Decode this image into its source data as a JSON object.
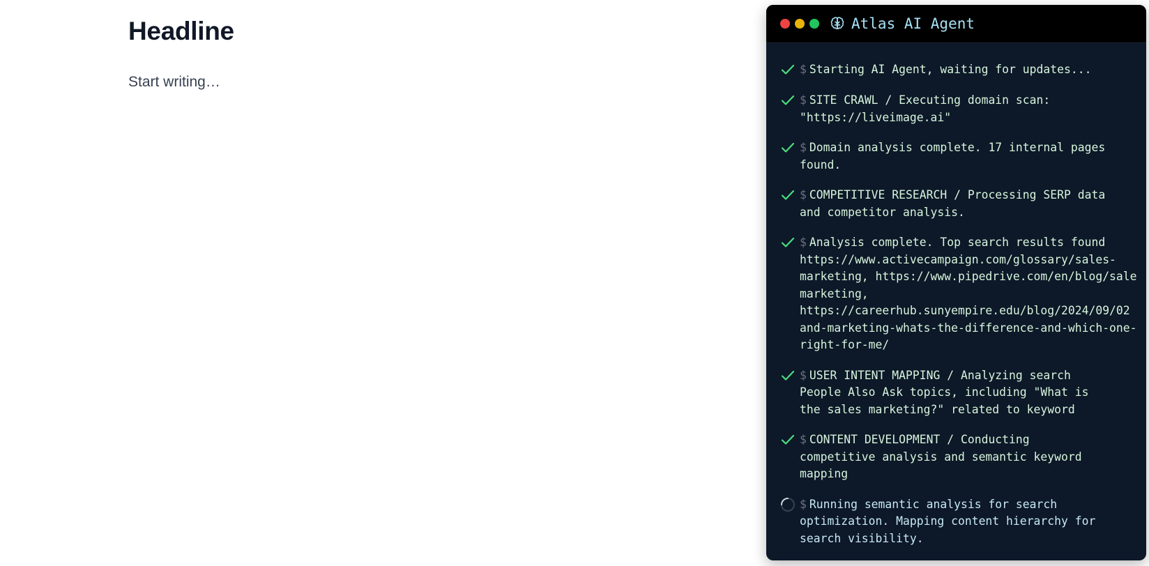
{
  "editor": {
    "headline": "Headline",
    "body_placeholder": "Start writing…"
  },
  "agent": {
    "title": "Atlas AI Agent",
    "title_icon": "brain-icon",
    "window_controls": [
      "close",
      "minimize",
      "maximize"
    ],
    "colors": {
      "background": "#0d1828",
      "titlebar": "#000000",
      "accent_check": "#4ade80",
      "title_text": "#a5e1f5"
    },
    "prompt": "$",
    "entries": [
      {
        "status": "done",
        "lines": [
          "Starting AI Agent, waiting for updates..."
        ]
      },
      {
        "status": "done",
        "lines": [
          "SITE CRAWL / Executing domain scan:",
          "\"https://liveimage.ai\""
        ]
      },
      {
        "status": "done",
        "lines": [
          "Domain analysis complete. 17 internal pages",
          "found."
        ]
      },
      {
        "status": "done",
        "lines": [
          "COMPETITIVE RESEARCH / Processing SERP data",
          "and competitor analysis."
        ]
      },
      {
        "status": "done",
        "lines": [
          "Analysis complete. Top search results found",
          "https://www.activecampaign.com/glossary/sales-",
          "marketing, https://www.pipedrive.com/en/blog/sale",
          "marketing,",
          "https://careerhub.sunyempire.edu/blog/2024/09/02",
          "and-marketing-whats-the-difference-and-which-one-",
          "right-for-me/"
        ]
      },
      {
        "status": "done",
        "lines": [
          "USER INTENT MAPPING / Analyzing search",
          "People Also Ask topics, including \"What is",
          "the sales marketing?\" related to keyword"
        ]
      },
      {
        "status": "done",
        "lines": [
          "CONTENT DEVELOPMENT / Conducting",
          "competitive analysis and semantic keyword",
          "mapping"
        ]
      },
      {
        "status": "running",
        "lines": [
          "Running semantic analysis for search",
          "optimization. Mapping content hierarchy for",
          "search visibility."
        ]
      }
    ]
  }
}
